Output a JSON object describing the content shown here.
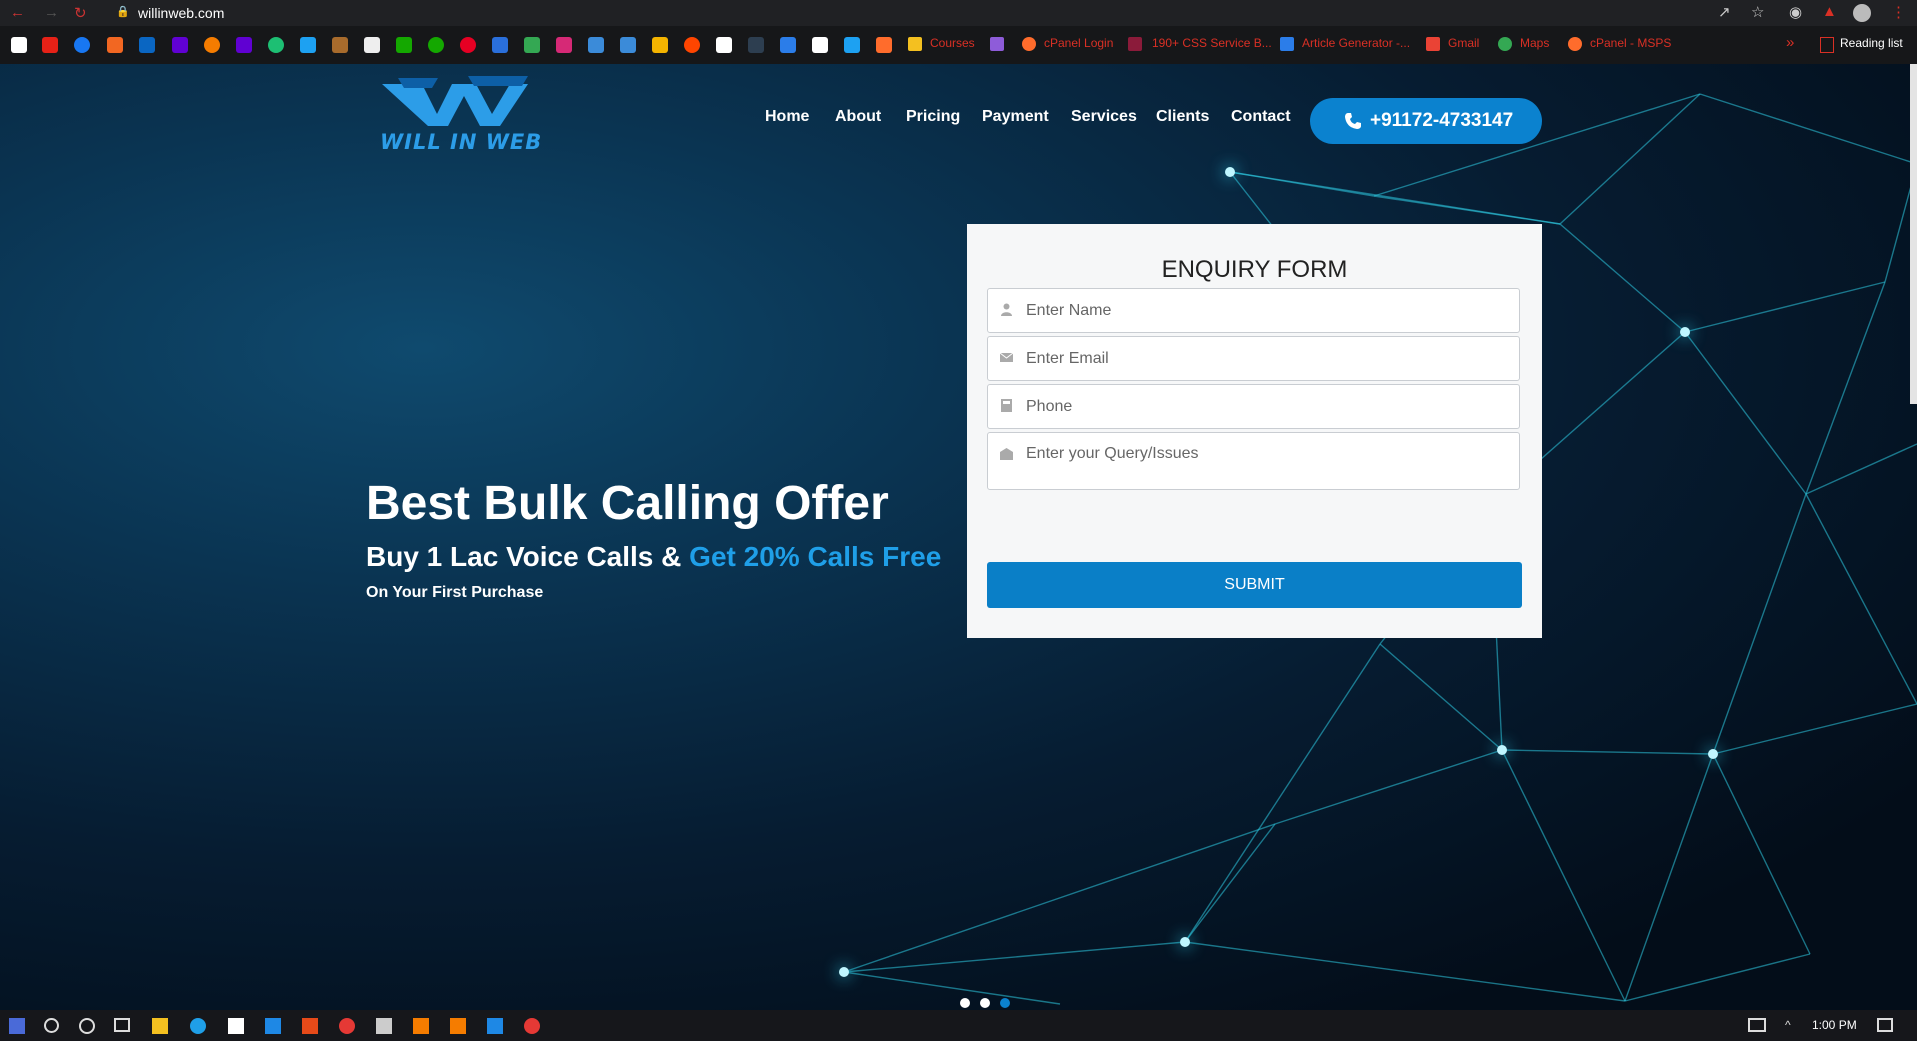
{
  "browser": {
    "url": "willinweb.com",
    "bookmarks": [
      {
        "label": "Courses",
        "color": "#f4c020"
      },
      {
        "label": "cPanel Login",
        "color": "#ff6c2c"
      },
      {
        "label": "190+ CSS Service B...",
        "color": "#8b1b3a"
      },
      {
        "label": "Article Generator -...",
        "color": "#2b7de9"
      },
      {
        "label": "Gmail",
        "color": "#ea4335"
      },
      {
        "label": "Maps",
        "color": "#34a853"
      },
      {
        "label": "cPanel - MSPS",
        "color": "#ff6c2c"
      }
    ],
    "reading_list": "Reading list"
  },
  "site": {
    "logo_text": "WILL IN WEB",
    "menu": [
      "Home",
      "About",
      "Pricing",
      "Payment",
      "Services",
      "Clients",
      "Contact"
    ],
    "phone": "+91172-4733147"
  },
  "hero": {
    "headline": "Best Bulk Calling Offer",
    "sub_plain": "Buy 1 Lac Voice Calls &",
    "sub_highlight": "Get 20% Calls Free",
    "small": "On Your First Purchase",
    "slides": 3,
    "active_slide": 3
  },
  "form": {
    "title": "ENQUIRY FORM",
    "name_placeholder": "Enter Name",
    "email_placeholder": "Enter Email",
    "phone_placeholder": "Phone",
    "query_placeholder": "Enter your Query/Issues",
    "submit": "SUBMIT"
  },
  "taskbar": {
    "time": "1:00 PM"
  },
  "colors": {
    "accent": "#0b82cf",
    "highlight": "#1f9fe8",
    "bookmark_red": "#d93025"
  }
}
